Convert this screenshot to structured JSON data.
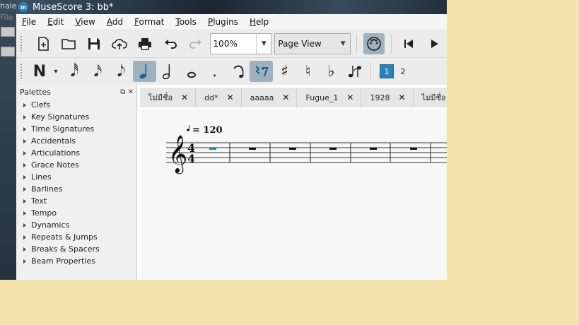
{
  "desktop": {
    "fragment_top": "hale",
    "fragment_file": "File"
  },
  "window": {
    "title": "MuseScore 3: bb*",
    "icon": "musescore-icon"
  },
  "menu": [
    "File",
    "Edit",
    "View",
    "Add",
    "Format",
    "Tools",
    "Plugins",
    "Help"
  ],
  "toolbar": {
    "zoom": "100%",
    "view_mode": "Page View"
  },
  "note_input": {
    "voice_active": "1",
    "voice_next": "2"
  },
  "palettes": {
    "title": "Palettes",
    "items": [
      "Clefs",
      "Key Signatures",
      "Time Signatures",
      "Accidentals",
      "Articulations",
      "Grace Notes",
      "Lines",
      "Barlines",
      "Text",
      "Tempo",
      "Dynamics",
      "Repeats & Jumps",
      "Breaks & Spacers",
      "Beam Properties"
    ]
  },
  "tabs": [
    {
      "label": "ไม่มีชื่อ"
    },
    {
      "label": "dd*"
    },
    {
      "label": "aaaaa"
    },
    {
      "label": "Fugue_1"
    },
    {
      "label": "1928"
    },
    {
      "label": "ไม่มีชื่อ"
    }
  ],
  "score": {
    "tempo": "= 120",
    "time_signature_top": "4",
    "time_signature_bottom": "4",
    "accent_color": "#2a80b9"
  }
}
